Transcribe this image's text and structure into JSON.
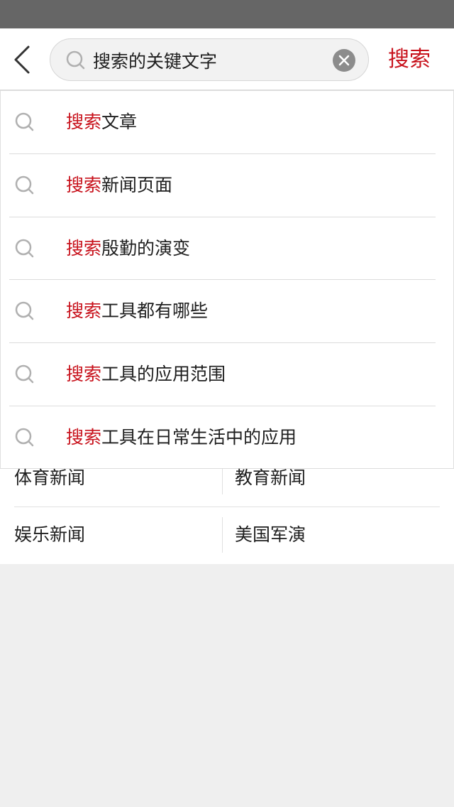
{
  "search": {
    "query": "搜索的关键文字",
    "submit_label": "搜索"
  },
  "suggestions": [
    {
      "highlight": "搜索",
      "rest": "文章"
    },
    {
      "highlight": "搜索",
      "rest": "新闻页面"
    },
    {
      "highlight": "搜索",
      "rest": "殷勤的演变"
    },
    {
      "highlight": "搜索",
      "rest": "工具都有哪些"
    },
    {
      "highlight": "搜索",
      "rest": "工具的应用范围"
    },
    {
      "highlight": "搜索",
      "rest": "工具在日常生活中的应用"
    }
  ],
  "tags": [
    {
      "label": "体育新闻"
    },
    {
      "label": "教育新闻"
    },
    {
      "label": "娱乐新闻"
    },
    {
      "label": "美国军演"
    }
  ],
  "icons": {
    "back": "chevron-left-icon",
    "search": "search-icon",
    "clear": "close-circle-icon"
  },
  "colors": {
    "accent": "#c8121c",
    "status_bar": "#666666",
    "page_background": "#efefef",
    "text": "#1e1e1e"
  }
}
